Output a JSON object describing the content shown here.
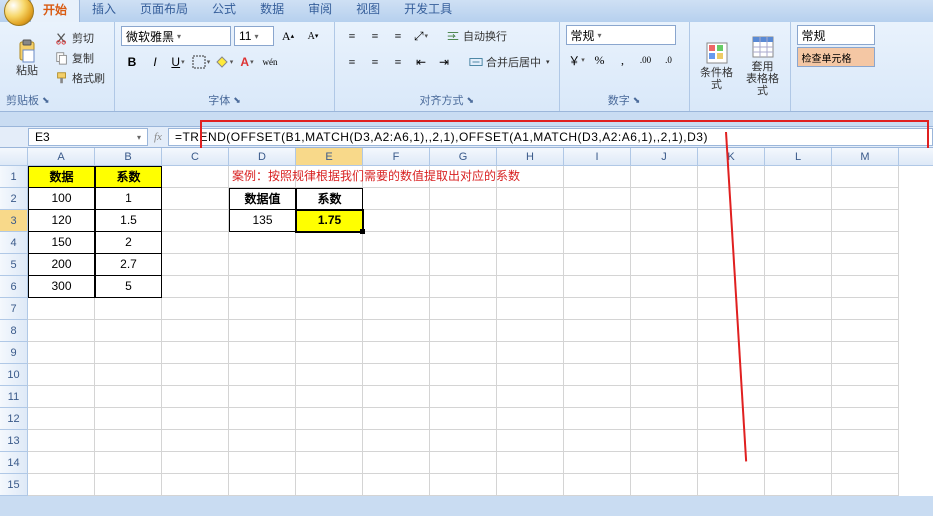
{
  "tabs": {
    "items": [
      "开始",
      "插入",
      "页面布局",
      "公式",
      "数据",
      "审阅",
      "视图",
      "开发工具"
    ],
    "active": 0
  },
  "ribbon": {
    "clipboard": {
      "paste": "粘贴",
      "cut": "剪切",
      "copy": "复制",
      "fmtpaint": "格式刷",
      "label": "剪贴板"
    },
    "font": {
      "name": "微软雅黑",
      "size": "11",
      "label": "字体"
    },
    "align": {
      "wrap": "自动换行",
      "merge": "合并后居中",
      "label": "对齐方式"
    },
    "number": {
      "format": "常规",
      "label": "数字"
    },
    "styles": {
      "cond": "条件格式",
      "tbl": "套用\n表格格式",
      "normal": "常规",
      "check": "检查单元格"
    }
  },
  "fbar": {
    "cellref": "E3",
    "formula": "=TREND(OFFSET(B1,MATCH(D3,A2:A6,1),,2,1),OFFSET(A1,MATCH(D3,A2:A6,1),,2,1),D3)"
  },
  "columns": [
    "A",
    "B",
    "C",
    "D",
    "E",
    "F",
    "G",
    "H",
    "I",
    "J",
    "K",
    "L",
    "M"
  ],
  "rowcount": 15,
  "annotation": "案例：按照规律根据我们需要的数值提取出对应的系数",
  "table1": {
    "headers": [
      "数据",
      "系数"
    ],
    "rows": [
      [
        "100",
        "1"
      ],
      [
        "120",
        "1.5"
      ],
      [
        "150",
        "2"
      ],
      [
        "200",
        "2.7"
      ],
      [
        "300",
        "5"
      ]
    ]
  },
  "table2": {
    "headers": [
      "数据值",
      "系数"
    ],
    "rows": [
      [
        "135",
        "1.75"
      ]
    ]
  },
  "active": {
    "row": 3,
    "col": "E"
  }
}
